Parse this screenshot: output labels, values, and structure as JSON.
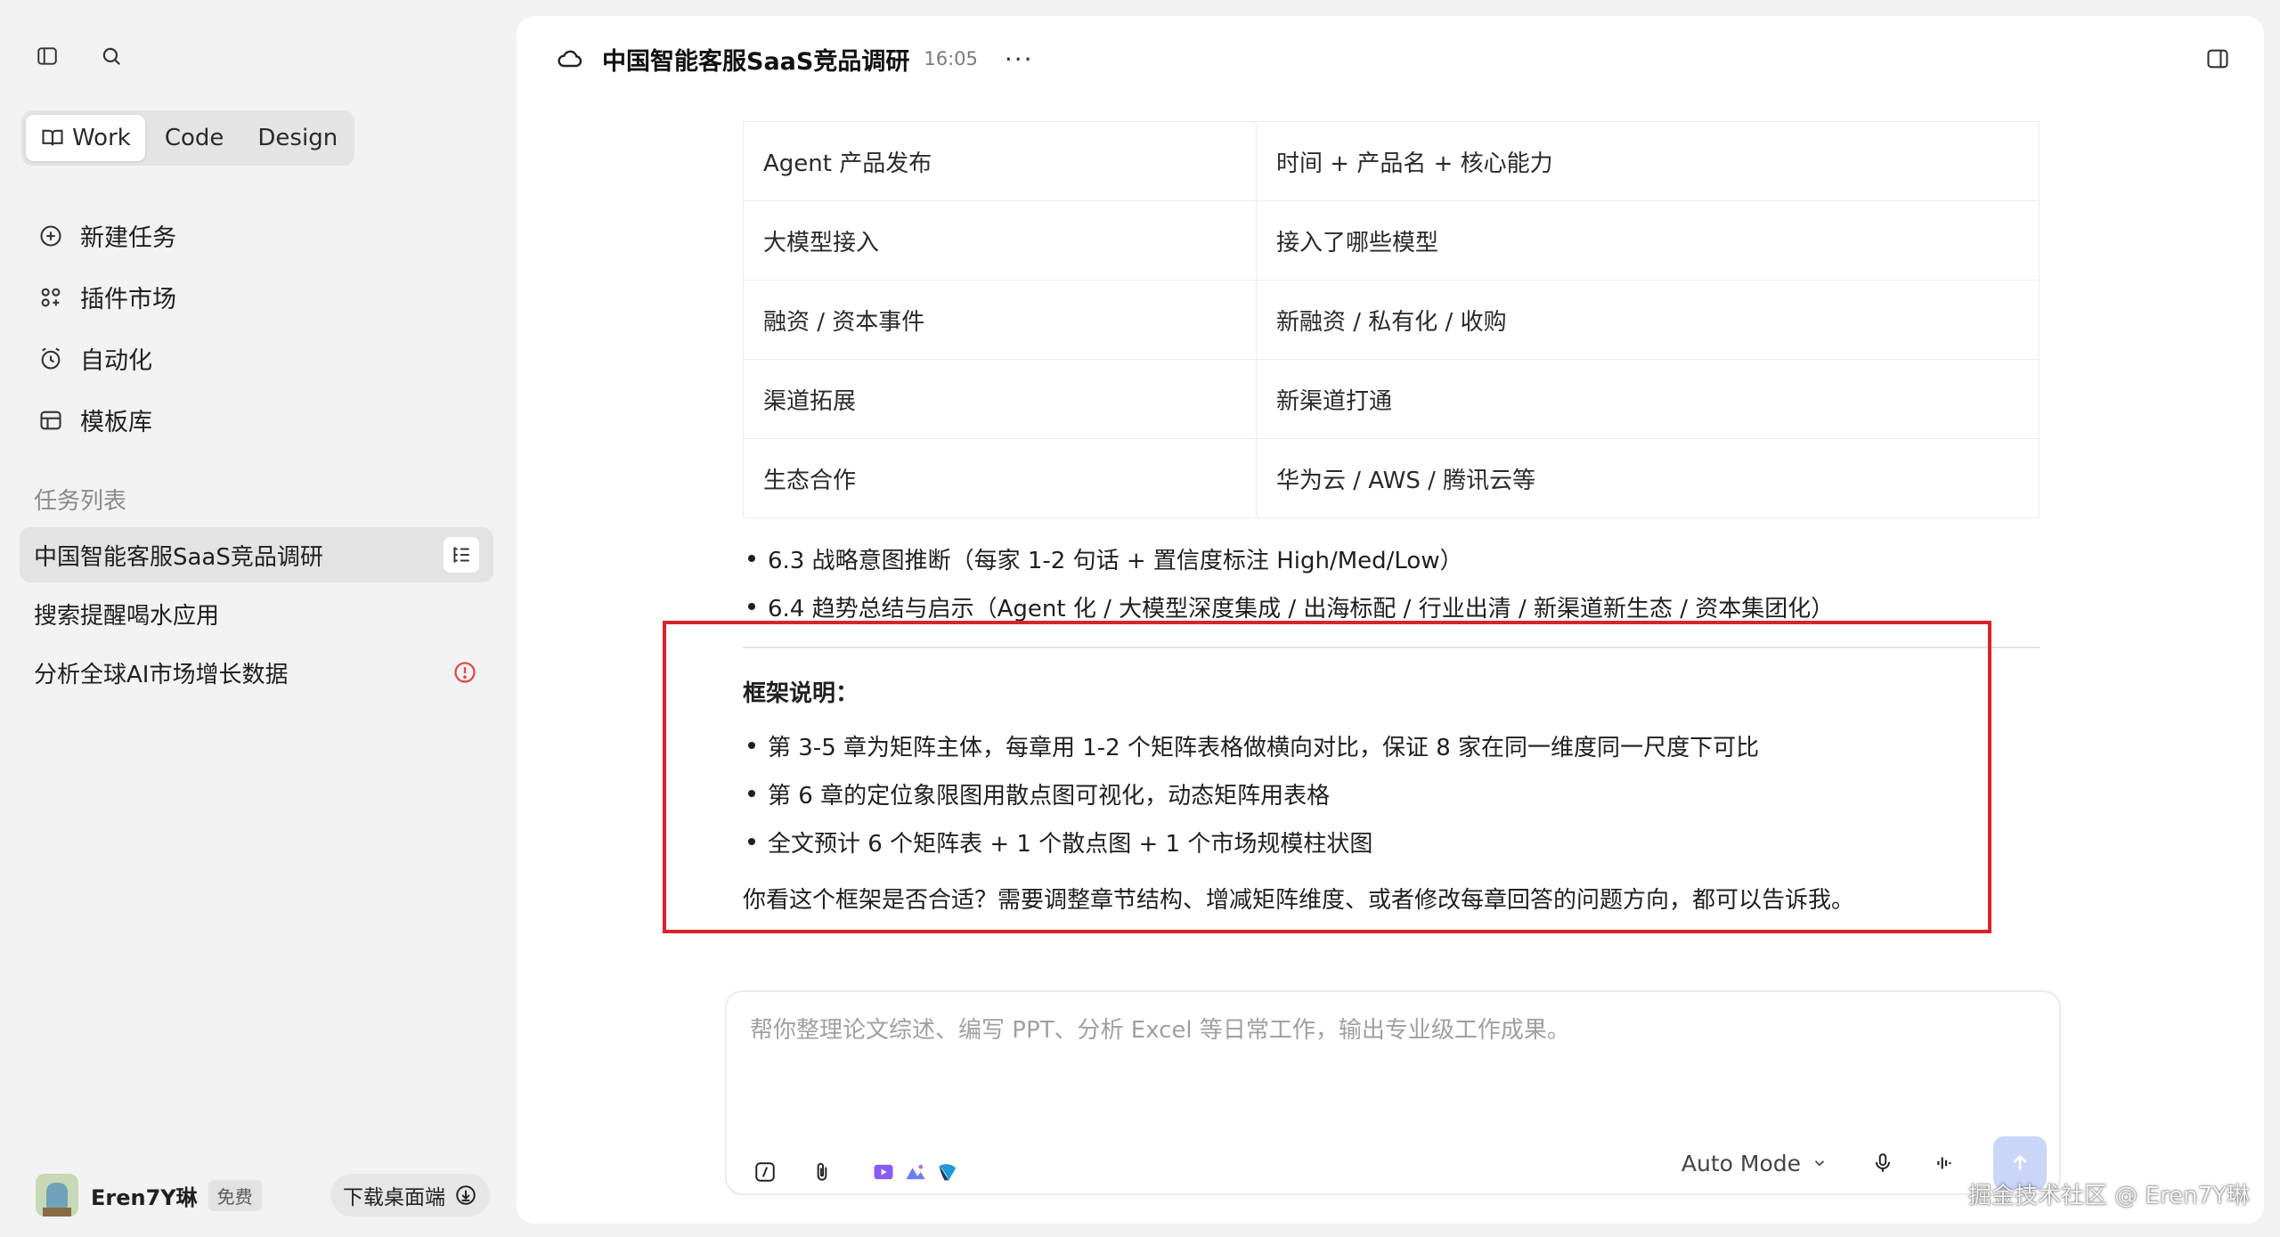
{
  "sidebar": {
    "modes": [
      {
        "label": "Work",
        "active": true
      },
      {
        "label": "Code",
        "active": false
      },
      {
        "label": "Design",
        "active": false
      }
    ],
    "nav": [
      {
        "label": "新建任务",
        "icon": "plus-circle-icon"
      },
      {
        "label": "插件市场",
        "icon": "plugin-grid-icon"
      },
      {
        "label": "自动化",
        "icon": "alarm-clock-icon"
      },
      {
        "label": "模板库",
        "icon": "template-icon"
      }
    ],
    "task_section_title": "任务列表",
    "tasks": [
      {
        "label": "中国智能客服SaaS竞品调研",
        "active": true
      },
      {
        "label": "搜索提醒喝水应用",
        "active": false
      },
      {
        "label": "分析全球AI市场增长数据",
        "active": false,
        "status": "warning"
      }
    ],
    "user": {
      "name": "Eren7Y琳",
      "plan": "免费"
    },
    "download_label": "下载桌面端"
  },
  "header": {
    "title": "中国智能客服SaaS竞品调研",
    "time": "16:05",
    "more": "···"
  },
  "content": {
    "table_rows": [
      [
        "Agent 产品发布",
        "时间 + 产品名 + 核心能力"
      ],
      [
        "大模型接入",
        "接入了哪些模型"
      ],
      [
        "融资 / 资本事件",
        "新融资 / 私有化 / 收购"
      ],
      [
        "渠道拓展",
        "新渠道打通"
      ],
      [
        "生态合作",
        "华为云 / AWS / 腾讯云等"
      ]
    ],
    "bullets": [
      "6.3 战略意图推断（每家 1-2 句话 + 置信度标注 High/Med/Low）",
      "6.4 趋势总结与启示（Agent 化 / 大模型深度集成 / 出海标配 / 行业出清 / 新渠道新生态 / 资本集团化）"
    ],
    "framework_title": "框架说明：",
    "framework_bullets": [
      "第 3-5 章为矩阵主体，每章用 1-2 个矩阵表格做横向对比，保证 8 家在同一维度同一尺度下可比",
      "第 6 章的定位象限图用散点图可视化，动态矩阵用表格",
      "全文预计 6 个矩阵表 + 1 个散点图 + 1 个市场规模柱状图"
    ],
    "closing": "你看这个框架是否合适？需要调整章节结构、增减矩阵维度、或者修改每章回答的问题方向，都可以告诉我。"
  },
  "composer": {
    "placeholder": "帮你整理论文综述、编写 PPT、分析 Excel 等日常工作，输出专业级工作成果。",
    "mode_label": "Auto Mode"
  },
  "watermark": "掘金技术社区 @ Eren7Y琳",
  "colors": {
    "highlight": "#d9232b",
    "send_button": "#c9d6f7",
    "warning": "#e5484d"
  }
}
